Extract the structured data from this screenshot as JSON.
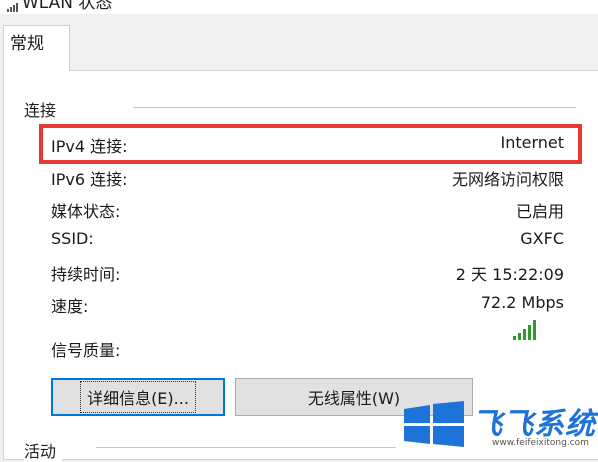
{
  "window": {
    "title": "WLAN 状态",
    "title_icon": "wifi-signal-icon"
  },
  "tabs": [
    {
      "label": "常规",
      "selected": true
    }
  ],
  "connection": {
    "group_label": "连接",
    "rows": [
      {
        "label": "IPv4 连接:",
        "value": "Internet"
      },
      {
        "label": "IPv6 连接:",
        "value": "无网络访问权限"
      },
      {
        "label": "媒体状态:",
        "value": "已启用"
      },
      {
        "label": "SSID:",
        "value": "GXFC"
      },
      {
        "label": "持续时间:",
        "value": "2 天 15:22:09"
      },
      {
        "label": "速度:",
        "value": "72.2 Mbps"
      }
    ],
    "signal_label": "信号质量:",
    "signal_icon": "signal-strength-icon",
    "signal_color": "#2e9a2e"
  },
  "buttons": {
    "details": "详细信息(E)...",
    "wireless_props": "无线属性(W)"
  },
  "activity": {
    "group_label": "活动"
  },
  "watermark": {
    "brand": "飞飞系统",
    "url": "www.feifeixitong.com",
    "color": "#1e73d8"
  },
  "highlight_color": "#e53935"
}
